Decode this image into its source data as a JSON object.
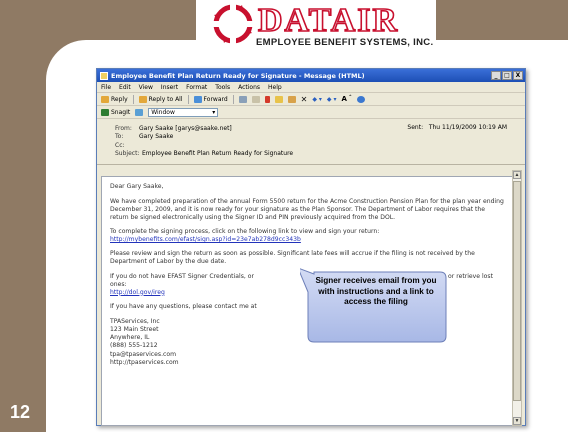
{
  "slide": {
    "number": "12",
    "company_subtitle": "EMPLOYEE BENEFIT SYSTEMS, INC.",
    "logo_word": "DATAIR"
  },
  "window": {
    "title": "Employee Benefit Plan Return Ready for Signature - Message (HTML)",
    "controls": [
      "_",
      "□",
      "X"
    ]
  },
  "menu": [
    "File",
    "Edit",
    "View",
    "Insert",
    "Format",
    "Tools",
    "Actions",
    "Help"
  ],
  "toolbar": {
    "reply": "Reply",
    "reply_all": "Reply to All",
    "forward": "Forward",
    "snagit": "SnagIt",
    "window_dropdown": "Window"
  },
  "headers": {
    "from_label": "From:",
    "from_value": "Gary Saake [garys@saake.net]",
    "sent_label": "Sent:",
    "sent_value": "Thu 11/19/2009 10:19 AM",
    "to_label": "To:",
    "to_value": "Gary Saake",
    "cc_label": "Cc:",
    "cc_value": "",
    "subject_label": "Subject:",
    "subject_value": "Employee Benefit Plan Return Ready for Signature"
  },
  "email": {
    "greeting": "Dear Gary Saake,",
    "para1": "We have completed preparation of the annual Form 5500 return for the Acme Construction Pension Plan for the plan year ending December 31, 2009, and it is now ready for your signature as the Plan Sponsor. The Department of Labor requires that the return be signed electronically using the Signer ID and PIN previously acquired from the DOL.",
    "para2": "To complete the signing process, click on the following link to view and sign your return:",
    "sign_link": "http://mybenefits.com/efast/sign.asp?id=23e7ab278d9cc343b",
    "para3": "Please review and sign the return as soon as possible. Significant late fees will accrue if the filing is not received by the Department of Labor by the due date.",
    "para4_start": "If you do not have EFAST Signer Credentials, or",
    "para4_end": "to acquire credentials or retrieve lost ones:",
    "dol_link": "http://dol.gov/ireg",
    "para5": "If you have any questions, please contact me at",
    "signature": [
      "TPAServices, Inc",
      "123 Main Street",
      "Anywhere, IL",
      "(888) 555-1212",
      "tpa@tpaservices.com",
      "http://tpaservices.com"
    ]
  },
  "callout": {
    "text": "Signer receives email from you with instructions and a link to access the filing"
  },
  "colors": {
    "frame_brown": "#8f7a64",
    "logo_red": "#c8102e",
    "link_blue": "#2233bb",
    "callout_blue": "#b8c6ec"
  }
}
